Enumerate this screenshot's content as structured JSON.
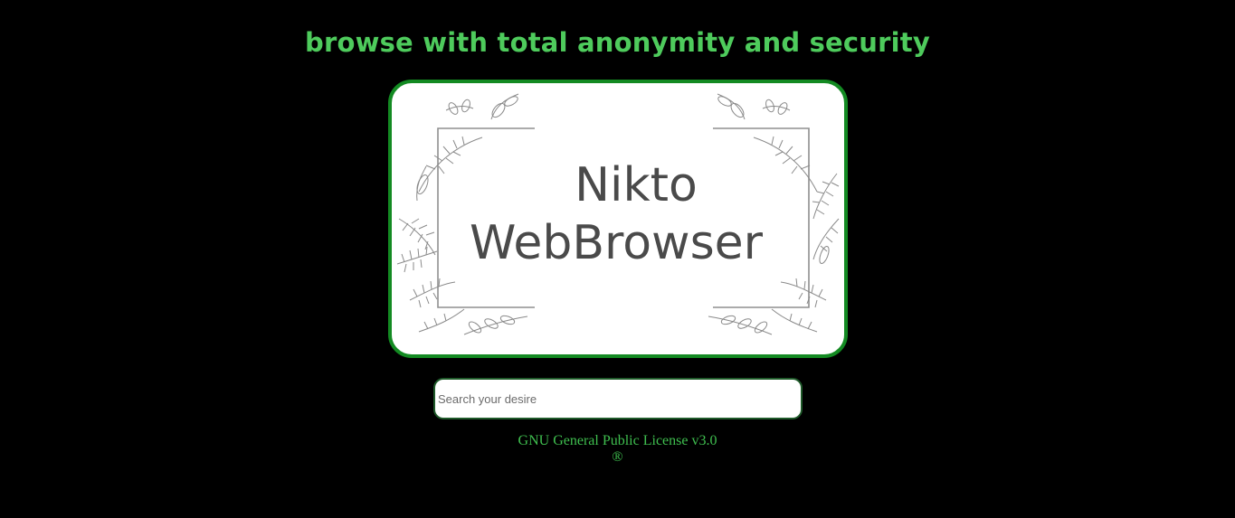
{
  "colors": {
    "background": "#000000",
    "accent_green": "#4ecb5c",
    "card_border": "#138a22",
    "footer_text": "#3fbf4f"
  },
  "header": {
    "headline": "browse with total anonymity and security"
  },
  "logo": {
    "line1": "Nikto",
    "line2": "WebBrowser",
    "decoration": "leaf-frame-icon"
  },
  "search": {
    "placeholder": "Search your desire",
    "value": ""
  },
  "footer": {
    "license": "GNU General Public License v3.0",
    "mark": "®"
  }
}
